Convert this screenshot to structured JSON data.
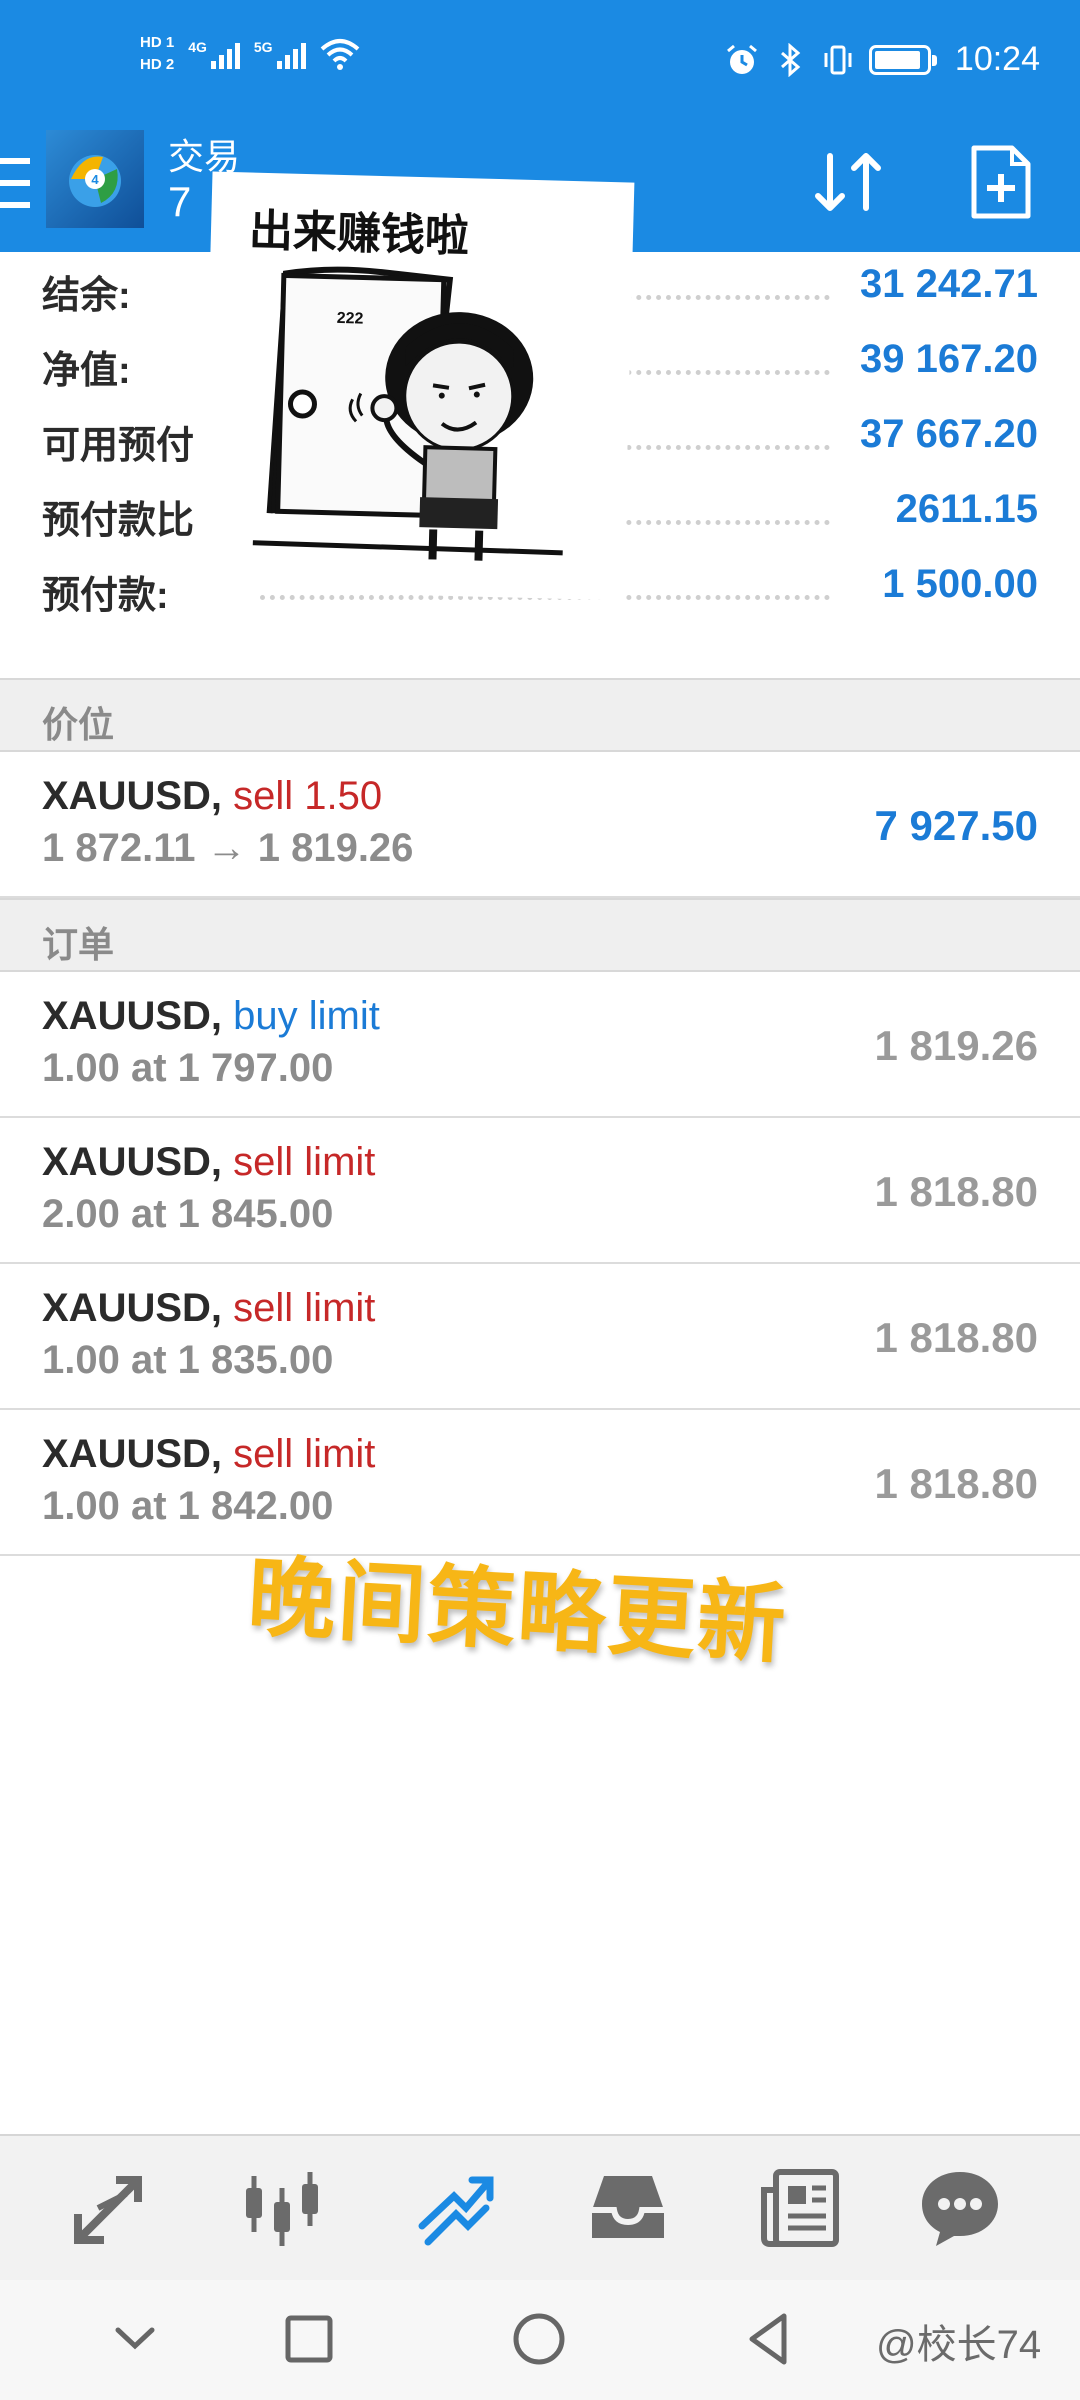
{
  "status_bar": {
    "sim1_label": "HD 1",
    "sim2_label": "HD 2",
    "net1": "4G",
    "net2": "5G",
    "battery_level": 0.8,
    "time": "10:24"
  },
  "app_bar": {
    "title": "交易",
    "account_prefix": "7",
    "icons": [
      "menu-icon",
      "metatrader-logo",
      "sort-icon",
      "new-order-icon"
    ]
  },
  "summary": [
    {
      "label": "结余:",
      "value": "31 242.71"
    },
    {
      "label": "净值:",
      "value": "39 167.20"
    },
    {
      "label": "可用预付",
      "value": "37 667.20"
    },
    {
      "label": "预付款比",
      "value": "2611.15"
    },
    {
      "label": "预付款:",
      "value": "1 500.00"
    }
  ],
  "positions_section": {
    "title": "价位"
  },
  "positions": [
    {
      "symbol": "XAUUSD,",
      "action": "sell 1.50",
      "detail": "1 872.11 → 1 819.26",
      "value": "7 927.50"
    }
  ],
  "orders_section": {
    "title": "订单"
  },
  "orders": [
    {
      "symbol": "XAUUSD,",
      "action": "buy limit",
      "detail": "1.00 at 1 797.00",
      "value": "1 819.26"
    },
    {
      "symbol": "XAUUSD,",
      "action": "sell limit",
      "detail": "2.00 at 1 845.00",
      "value": "1 818.80"
    },
    {
      "symbol": "XAUUSD,",
      "action": "sell limit",
      "detail": "1.00 at 1 835.00",
      "value": "1 818.80"
    },
    {
      "symbol": "XAUUSD,",
      "action": "sell limit",
      "detail": "1.00 at 1 842.00",
      "value": "1 818.80"
    }
  ],
  "overlays": {
    "meme_caption": "出来赚钱啦",
    "meme_door_number": "222",
    "evening_text": "晚间策略更新"
  },
  "bottom_nav": {
    "items": [
      "quotes-icon",
      "chart-candles-icon",
      "trade-icon",
      "history-inbox-icon",
      "news-icon",
      "chat-icon"
    ],
    "active": "trade-icon"
  },
  "system_nav": {
    "watermark": "@校长74"
  },
  "colors": {
    "brand_blue": "#1b8ae3",
    "value_blue": "#1b7bd6",
    "sell_red": "#c62828",
    "overlay_gold": "#f7b616"
  }
}
